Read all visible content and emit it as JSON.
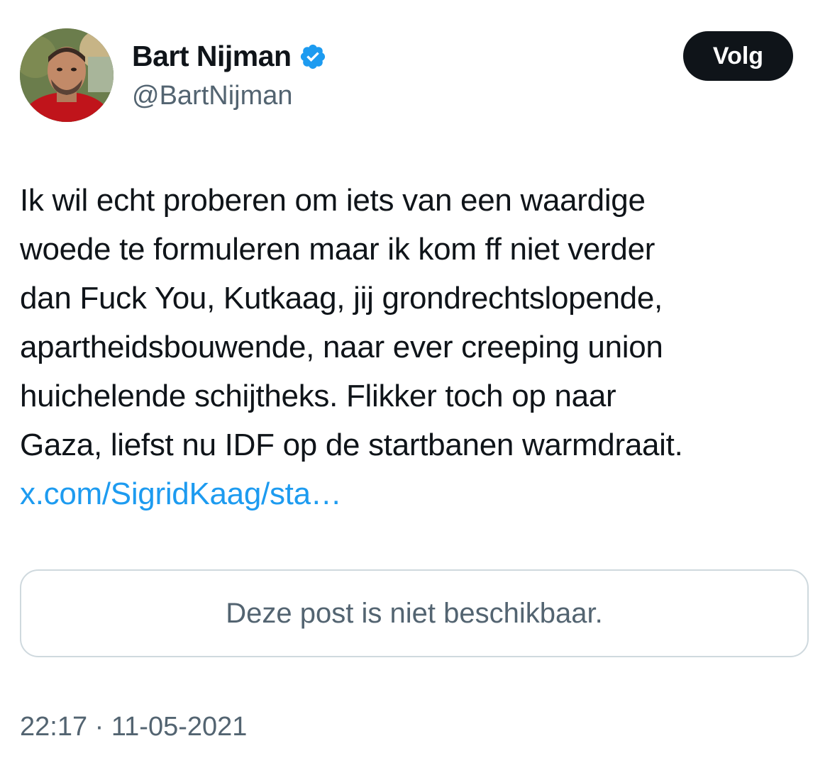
{
  "author": {
    "display_name": "Bart Nijman",
    "handle": "@BartNijman",
    "verified_icon": "verified-badge-icon"
  },
  "follow_button": {
    "label": "Volg"
  },
  "tweet": {
    "lines": [
      "Ik wil echt proberen om iets van een waardige",
      "woede te formuleren maar ik kom ff niet verder",
      "dan Fuck You, Kutkaag, jij grondrechtslopende,",
      "apartheidsbouwende, naar ever creeping union",
      "huichelende schijtheks. Flikker toch op naar",
      "Gaza, liefst nu IDF op de startbanen warmdraait."
    ],
    "link_text": "x.com/SigridKaag/sta…"
  },
  "quoted_post": {
    "unavailable_text": "Deze post is niet beschikbaar."
  },
  "meta": {
    "timestamp": "22:17 · 11-05-2021"
  },
  "colors": {
    "link": "#1d9bf0",
    "verified": "#1d9bf0",
    "secondary_text": "#536471",
    "primary_text": "#0f1419",
    "border": "#cfd9de"
  }
}
